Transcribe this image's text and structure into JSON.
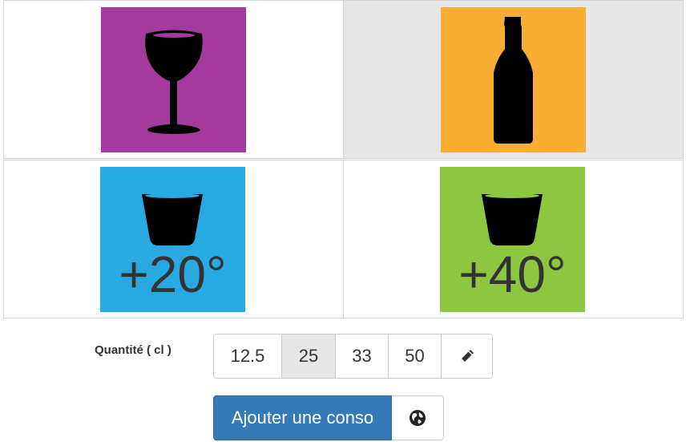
{
  "drinks": [
    {
      "name": "Vin",
      "color": "#a53a9d",
      "icon": "wine-glass-icon"
    },
    {
      "name": "Bière",
      "color": "#f9ae33",
      "icon": "beer-bottle-icon"
    },
    {
      "name": "Spiritueux 20",
      "color": "#29a9e1",
      "icon": "shot-glass-icon",
      "degree": "+20°"
    },
    {
      "name": "Spiritueux 40",
      "color": "#8dc63f",
      "icon": "shot-glass-icon",
      "degree": "+40°"
    }
  ],
  "quantity": {
    "label": "Quantité ( cl )",
    "options": [
      "12.5",
      "25",
      "33",
      "50"
    ],
    "selected": "25",
    "edit_icon": "pencil-icon"
  },
  "actions": {
    "add_label": "Ajouter une conso",
    "location_icon": "globe-icon"
  },
  "selected_drink": "Bière"
}
